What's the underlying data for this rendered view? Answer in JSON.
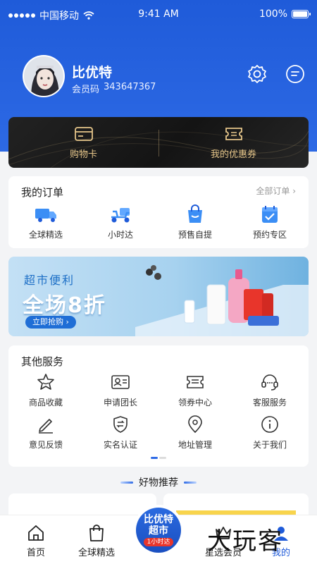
{
  "status_bar": {
    "carrier": "中国移动",
    "time": "9:41 AM",
    "battery": "100%"
  },
  "profile": {
    "name": "比优特",
    "member_label": "会员码",
    "member_code": "343647367"
  },
  "vip_card": {
    "shopping_card": "购物卡",
    "coupons": "我的优惠券"
  },
  "orders": {
    "title": "我的订单",
    "all_orders": "全部订单 ›",
    "items": [
      {
        "label": "全球精选",
        "icon": "global-truck-icon"
      },
      {
        "label": "小时达",
        "icon": "scooter-icon"
      },
      {
        "label": "预售自提",
        "icon": "shopping-bag-icon"
      },
      {
        "label": "预约专区",
        "icon": "calendar-check-icon"
      }
    ]
  },
  "banner": {
    "subtitle": "超市便利",
    "headline": "全场8折",
    "cta": "立即抢购 ›"
  },
  "services": {
    "title": "其他服务",
    "items": [
      {
        "label": "商品收藏",
        "icon": "star-icon"
      },
      {
        "label": "申请团长",
        "icon": "id-card-icon"
      },
      {
        "label": "领券中心",
        "icon": "ticket-icon"
      },
      {
        "label": "客服服务",
        "icon": "headset-icon"
      },
      {
        "label": "意见反馈",
        "icon": "pencil-icon"
      },
      {
        "label": "实名认证",
        "icon": "shield-icon"
      },
      {
        "label": "地址管理",
        "icon": "location-pin-icon"
      },
      {
        "label": "关于我们",
        "icon": "info-icon"
      }
    ]
  },
  "recommend_title": "好物推荐",
  "tab_bar": {
    "home": "首页",
    "global": "全球精选",
    "center": {
      "line1": "比优特",
      "line2": "超市",
      "line3": "1小时达"
    },
    "member": "星选会员",
    "mine": "我的"
  },
  "watermark": "大玩客",
  "colors": {
    "primary": "#1f5bd9",
    "gold": "#e6c68a",
    "banner_red": "#e8352b"
  }
}
